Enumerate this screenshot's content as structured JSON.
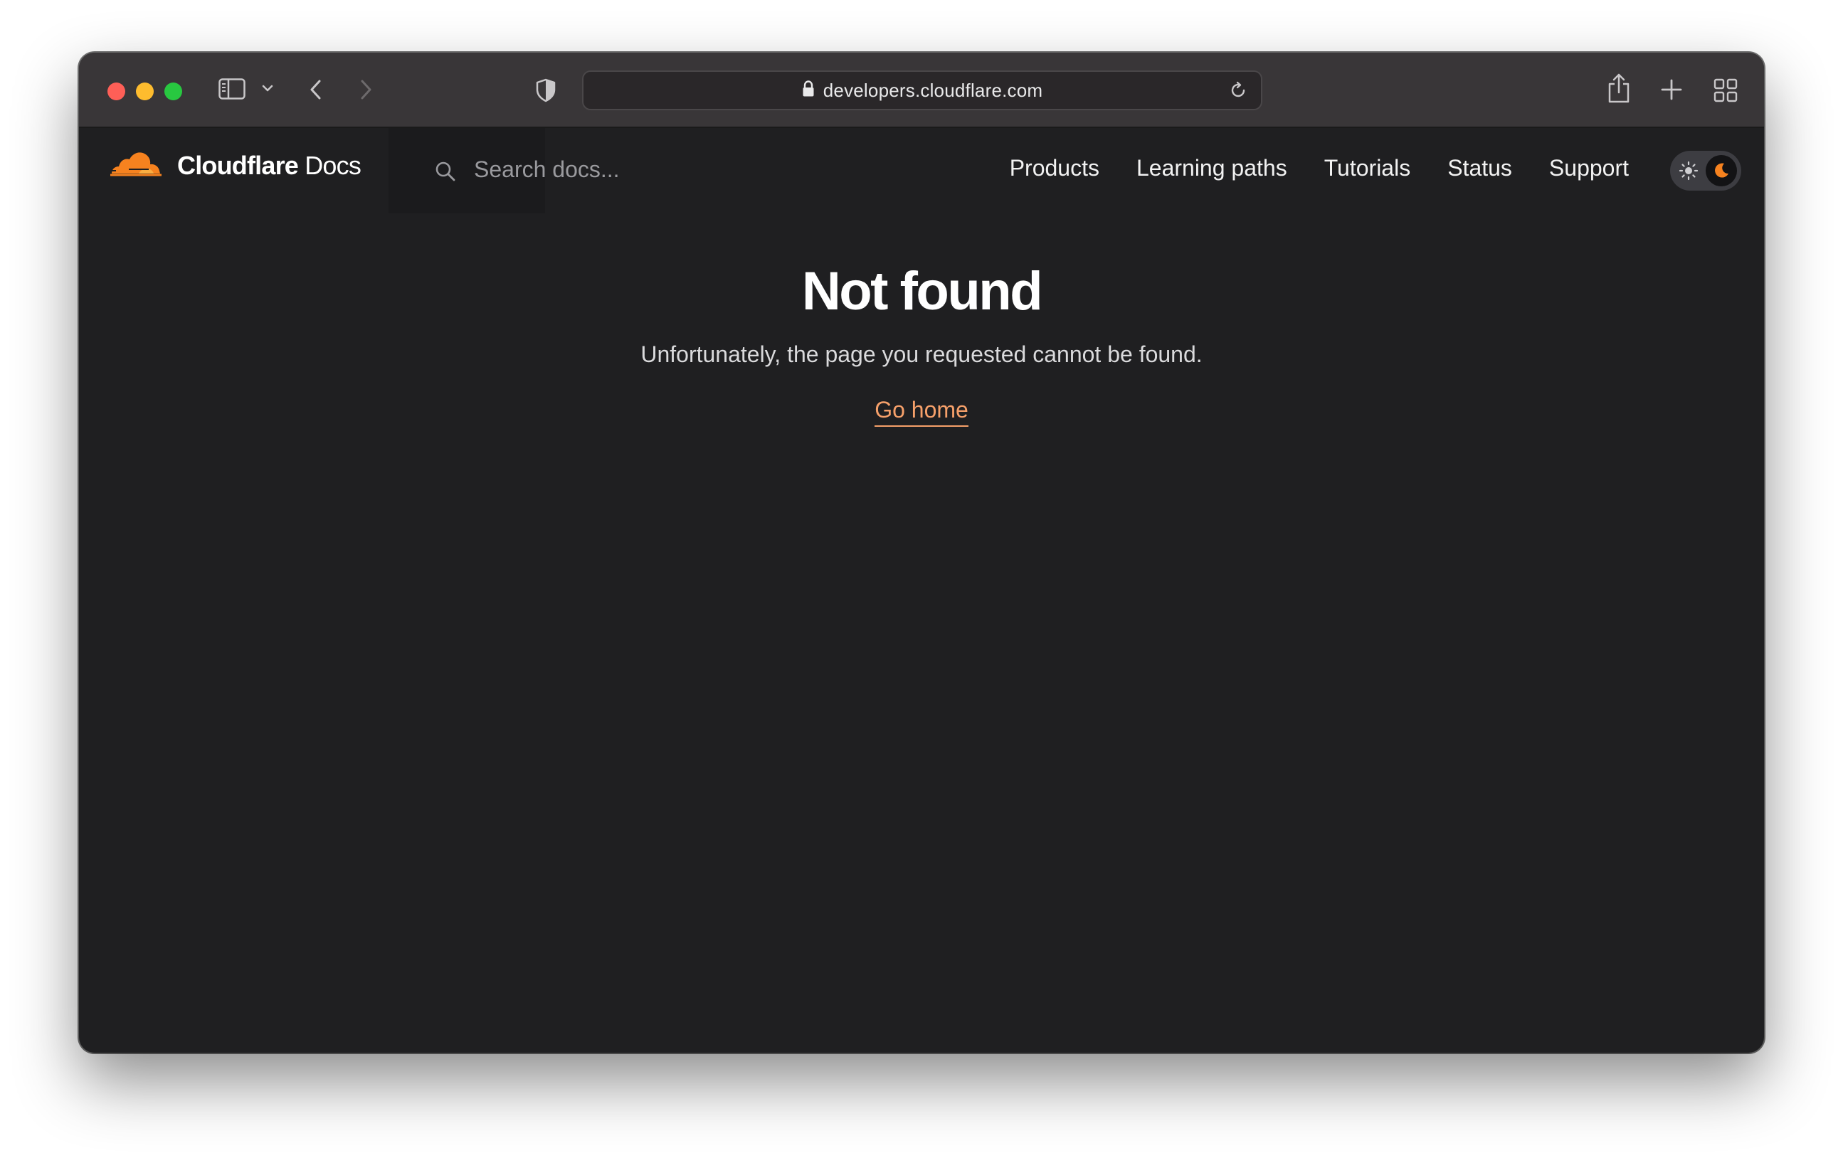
{
  "browser": {
    "url": "developers.cloudflare.com",
    "icons": {
      "sidebar": "sidebar-icon",
      "back": "chevron-left-icon",
      "forward": "chevron-right-icon",
      "privacy": "shield-icon",
      "lock": "lock-icon",
      "reload": "reload-icon",
      "share": "share-icon",
      "new_tab": "plus-icon",
      "tabs": "grid-icon"
    }
  },
  "header": {
    "brand_bold": "Cloudflare",
    "brand_regular": "Docs",
    "search_placeholder": "Search docs...",
    "nav": [
      {
        "label": "Products"
      },
      {
        "label": "Learning paths"
      },
      {
        "label": "Tutorials"
      },
      {
        "label": "Status"
      },
      {
        "label": "Support"
      }
    ],
    "theme": "dark"
  },
  "main": {
    "title": "Not found",
    "message": "Unfortunately, the page you requested cannot be found.",
    "link_label": "Go home"
  },
  "colors": {
    "accent": "#f6821f",
    "link": "#f6a06a",
    "page_bg": "#1f1f21",
    "toolbar_bg": "#393638"
  }
}
